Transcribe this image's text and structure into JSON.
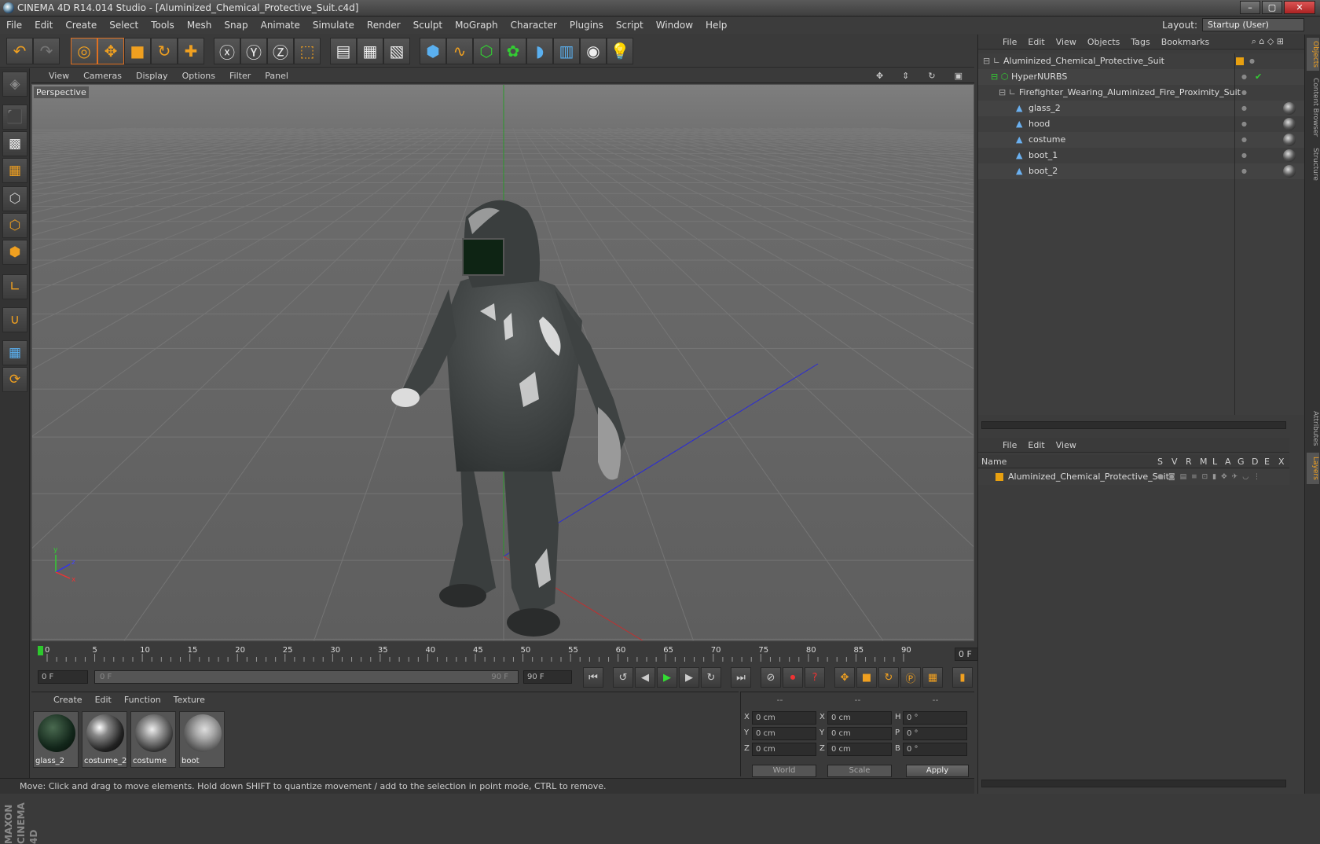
{
  "window": {
    "title": "CINEMA 4D R14.014 Studio - [Aluminized_Chemical_Protective_Suit.c4d]"
  },
  "menu": [
    "File",
    "Edit",
    "Create",
    "Select",
    "Tools",
    "Mesh",
    "Snap",
    "Animate",
    "Simulate",
    "Render",
    "Sculpt",
    "MoGraph",
    "Character",
    "Plugins",
    "Script",
    "Window",
    "Help"
  ],
  "layout": {
    "label": "Layout:",
    "value": "Startup (User)"
  },
  "viewport": {
    "menu": [
      "View",
      "Cameras",
      "Display",
      "Options",
      "Filter",
      "Panel"
    ],
    "label": "Perspective",
    "axis": {
      "y": "y",
      "z": "z",
      "x": "x"
    }
  },
  "timeline": {
    "ticks": [
      "0",
      "5",
      "10",
      "15",
      "20",
      "25",
      "30",
      "35",
      "40",
      "45",
      "50",
      "55",
      "60",
      "65",
      "70",
      "75",
      "80",
      "85",
      "90"
    ],
    "current": "0 F"
  },
  "transport": {
    "start": "0 F",
    "slider_left": "0 F",
    "slider_right": "90 F",
    "end": "90 F"
  },
  "materials": {
    "menu": [
      "Create",
      "Edit",
      "Function",
      "Texture"
    ],
    "items": [
      {
        "name": "glass_2"
      },
      {
        "name": "costume_2"
      },
      {
        "name": "costume"
      },
      {
        "name": "boot"
      }
    ]
  },
  "coords": {
    "headers": [
      "--",
      "--",
      "--"
    ],
    "rows": [
      {
        "a": "X",
        "av": "0 cm",
        "b": "X",
        "bv": "0 cm",
        "c": "H",
        "cv": "0 °"
      },
      {
        "a": "Y",
        "av": "0 cm",
        "b": "Y",
        "bv": "0 cm",
        "c": "P",
        "cv": "0 °"
      },
      {
        "a": "Z",
        "av": "0 cm",
        "b": "Z",
        "bv": "0 cm",
        "c": "B",
        "cv": "0 °"
      }
    ],
    "world": "World",
    "scale": "Scale",
    "apply": "Apply"
  },
  "status": "Move: Click and drag to move elements. Hold down SHIFT to quantize movement / add to the selection in point mode, CTRL to remove.",
  "objects": {
    "menu": [
      "File",
      "Edit",
      "View",
      "Objects",
      "Tags",
      "Bookmarks"
    ],
    "tree": [
      {
        "name": "Aluminized_Chemical_Protective_Suit",
        "depth": 0
      },
      {
        "name": "HyperNURBS",
        "depth": 1
      },
      {
        "name": "Firefighter_Wearing_Aluminized_Fire_Proximity_Suit",
        "depth": 2
      },
      {
        "name": "glass_2",
        "depth": 3
      },
      {
        "name": "hood",
        "depth": 3
      },
      {
        "name": "costume",
        "depth": 3
      },
      {
        "name": "boot_1",
        "depth": 3
      },
      {
        "name": "boot_2",
        "depth": 3
      }
    ]
  },
  "layers": {
    "menu": [
      "File",
      "Edit",
      "View"
    ],
    "header_name": "Name",
    "columns": [
      "S",
      "V",
      "R",
      "M",
      "L",
      "A",
      "G",
      "D",
      "E",
      "X"
    ],
    "rows": [
      {
        "name": "Aluminized_Chemical_Protective_Suit"
      }
    ]
  },
  "sidetabs": [
    "Objects",
    "Content Browser",
    "Structure",
    "Attributes",
    "Layers"
  ],
  "colors": {
    "accent": "#f0a020",
    "layer": "#e8a010"
  }
}
